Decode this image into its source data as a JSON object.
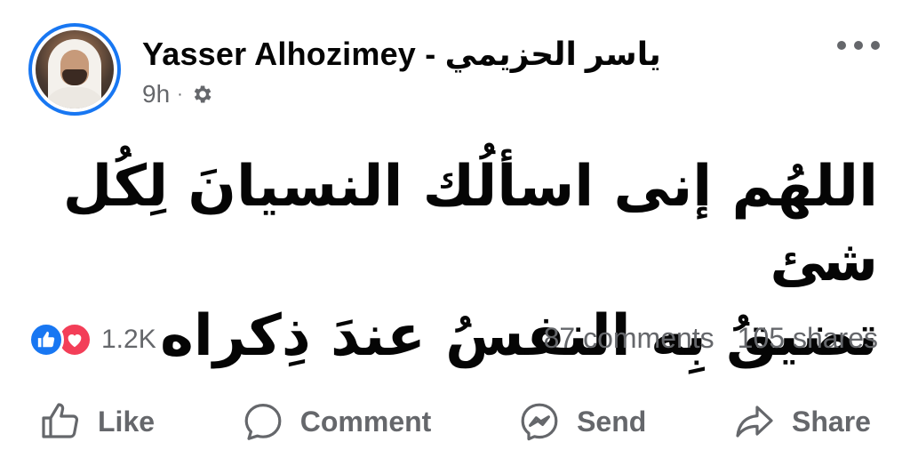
{
  "post": {
    "author": "Yasser Alhozimey - ياسر الحزيمي",
    "time": "9h",
    "separator": "·",
    "audience_icon": "gear-icon",
    "text_lines": [
      "اللهُم إنى اسألُك النسيانَ لِكُل شئ",
      "تضيقُ بِه النفسُ عندَ ذِكراه"
    ]
  },
  "engagement": {
    "reaction_icons": [
      "like-reaction-icon",
      "love-reaction-icon"
    ],
    "reactions_count": "1.2K",
    "comments": "87 comments",
    "shares": "105 shares"
  },
  "actions": {
    "like": "Like",
    "comment": "Comment",
    "send": "Send",
    "share": "Share"
  },
  "colors": {
    "accent": "#1877f2",
    "love": "#f33e58",
    "secondary_text": "#65676b"
  }
}
